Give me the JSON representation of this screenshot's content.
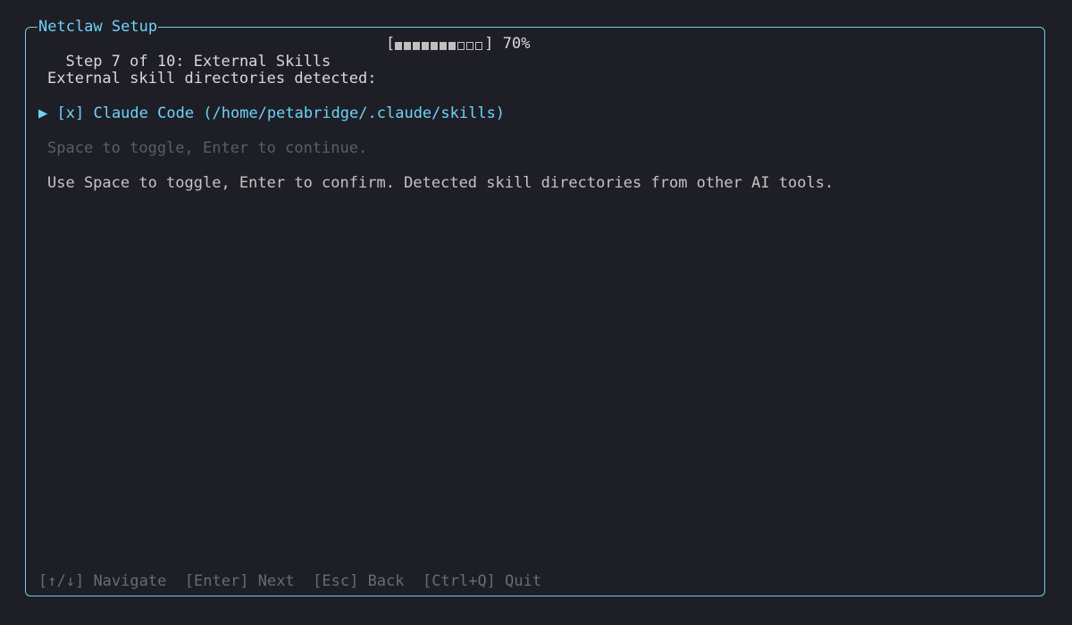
{
  "window": {
    "title": "Netclaw Setup"
  },
  "step": {
    "label": "Step 7 of 10: External Skills",
    "progress_percent": 70,
    "progress_text": "70%",
    "progress_cells_total": 10,
    "progress_cells_filled": 7
  },
  "main": {
    "heading": "External skill directories detected:",
    "items": [
      {
        "cursor": "▶",
        "checkbox": "[x]",
        "label": "Claude Code (/home/petabridge/.claude/skills)",
        "checked": true
      }
    ],
    "hint": "Space to toggle, Enter to continue.",
    "info": "Use Space to toggle, Enter to confirm. Detected skill directories from other AI tools."
  },
  "footer": {
    "keys": [
      {
        "key": "[↑/↓]",
        "action": "Navigate"
      },
      {
        "key": "[Enter]",
        "action": "Next"
      },
      {
        "key": "[Esc]",
        "action": "Back"
      },
      {
        "key": "[Ctrl+Q]",
        "action": "Quit"
      }
    ]
  },
  "colors": {
    "background": "#1d1e26",
    "accent": "#6fd3f7",
    "border": "#7ec8e3",
    "muted": "#5c5e66"
  }
}
